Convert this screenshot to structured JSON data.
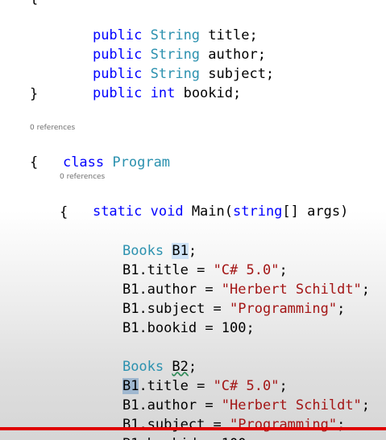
{
  "editor": {
    "lines": [
      {
        "id": "l1",
        "parts": [
          [
            "kw",
            "public"
          ],
          [
            "pl",
            " "
          ],
          [
            "ty",
            "String"
          ],
          [
            "pl",
            " title;"
          ]
        ]
      },
      {
        "id": "l2",
        "parts": [
          [
            "kw",
            "public"
          ],
          [
            "pl",
            " "
          ],
          [
            "ty",
            "String"
          ],
          [
            "pl",
            " author;"
          ]
        ]
      },
      {
        "id": "l3",
        "parts": [
          [
            "kw",
            "public"
          ],
          [
            "pl",
            " "
          ],
          [
            "ty",
            "String"
          ],
          [
            "pl",
            " subject;"
          ]
        ]
      },
      {
        "id": "l4",
        "parts": [
          [
            "kw",
            "public"
          ],
          [
            "pl",
            " "
          ],
          [
            "kw",
            "int"
          ],
          [
            "pl",
            " bookid;"
          ]
        ]
      }
    ],
    "codelens_class": "0 references",
    "codelens_main": "0 references",
    "class_keyword": "class",
    "class_name": "Program",
    "main_static": "static",
    "main_void": "void",
    "main_name": " Main(",
    "main_string": "string",
    "main_args": "[] args)",
    "close_brace": "}",
    "open_brace": "{",
    "b1_decl_type": "Books",
    "b1_decl_var": "B1",
    "b2_decl_type": "Books",
    "b2_decl_var": "B2",
    "assign_title": ".title = ",
    "assign_author": ".author = ",
    "assign_subject": ".subject = ",
    "assign_bookid": ".bookid = 100;",
    "val_title": "\"C# 5.0\"",
    "val_author": "\"Herbert Schildt\"",
    "val_subject": "\"Programming\"",
    "var_b1": "B1",
    "semicolon": ";"
  },
  "video": {
    "progress": 1.0,
    "progress_color": "#e00000"
  }
}
